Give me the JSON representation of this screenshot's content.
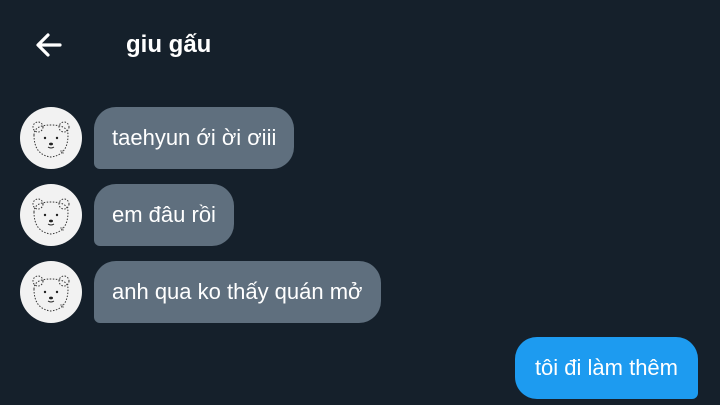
{
  "header": {
    "back_icon": "arrow-left-icon",
    "title": "giu gấu"
  },
  "contact": {
    "avatar_icon": "bear-avatar"
  },
  "messages": [
    {
      "direction": "incoming",
      "text": "taehyun ới ời ơiii"
    },
    {
      "direction": "incoming",
      "text": "em đâu rồi"
    },
    {
      "direction": "incoming",
      "text": "anh qua ko thấy quán mở"
    },
    {
      "direction": "outgoing",
      "text": "tôi đi làm thêm"
    }
  ],
  "colors": {
    "background": "#15202b",
    "incoming_bubble": "#5f6f7e",
    "outgoing_bubble": "#1d9bf0",
    "text": "#ffffff"
  }
}
